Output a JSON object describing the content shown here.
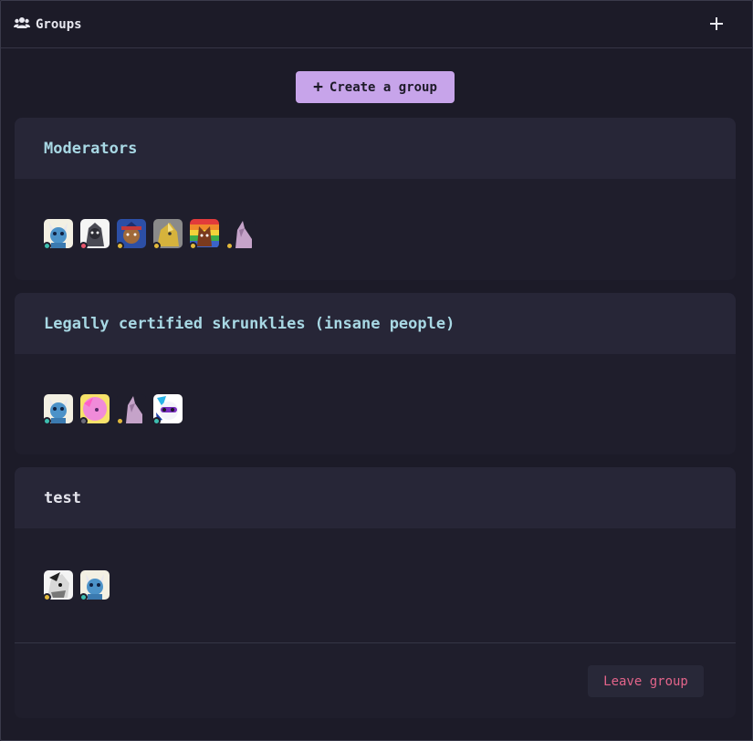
{
  "header": {
    "title": "Groups",
    "add_icon": "plus-icon",
    "groups_icon": "users-icon"
  },
  "create_button": {
    "label": "Create a group"
  },
  "groups": [
    {
      "name": "Moderators",
      "members": [
        {
          "avatar": "blue-cat",
          "status": "online"
        },
        {
          "avatar": "grey-wolf",
          "status": "dnd"
        },
        {
          "avatar": "dark-pony-blue-mane",
          "status": "idle"
        },
        {
          "avatar": "yellow-pony",
          "status": "idle"
        },
        {
          "avatar": "rainbow-fox",
          "status": "idle"
        },
        {
          "avatar": "lilac-unicorn",
          "status": "idle"
        }
      ]
    },
    {
      "name": "Legally certified skrunklies (insane people)",
      "members": [
        {
          "avatar": "blue-cat",
          "status": "online"
        },
        {
          "avatar": "pink-pony",
          "status": "offline"
        },
        {
          "avatar": "lilac-unicorn",
          "status": "idle"
        },
        {
          "avatar": "white-pony-goggles",
          "status": "online"
        }
      ]
    },
    {
      "name": "test",
      "members": [
        {
          "avatar": "sketch-pony",
          "status": "idle"
        },
        {
          "avatar": "blue-cat",
          "status": "online"
        }
      ],
      "leave_label": "Leave group"
    }
  ],
  "status_colors": {
    "online": "#3dbfb0",
    "dnd": "#e8566c",
    "idle": "#e2b93b",
    "offline": "#6b6b78"
  }
}
